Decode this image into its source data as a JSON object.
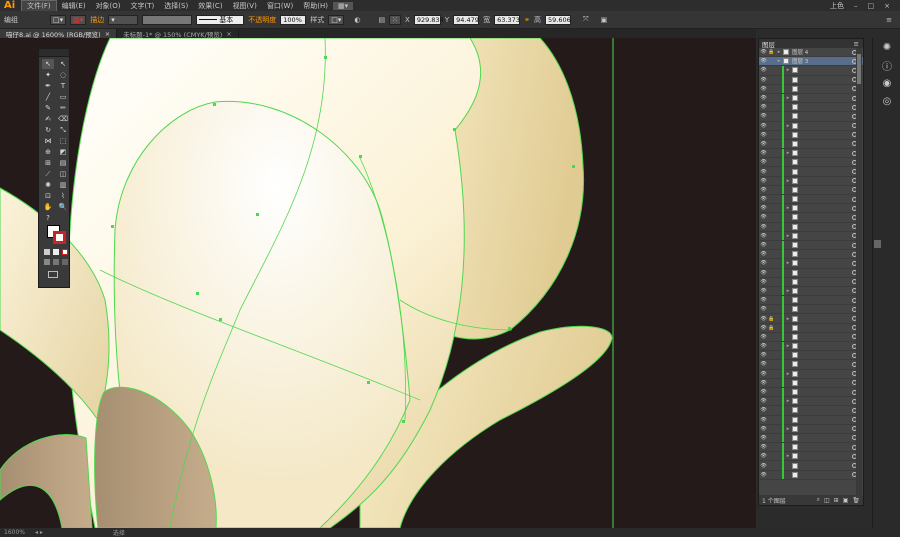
{
  "app": {
    "logo": "Ai",
    "menus": [
      "文件(F)",
      "编辑(E)",
      "对象(O)",
      "文字(T)",
      "选择(S)",
      "效果(C)",
      "视图(V)",
      "窗口(W)",
      "帮助(H)"
    ],
    "right_label": "上色",
    "window_buttons": [
      "–",
      "□",
      "×"
    ]
  },
  "controlbar": {
    "selection_label": "编组",
    "stroke_label": "描边",
    "stroke_style": "基本",
    "opacity_label": "不透明度",
    "opacity_value": "100%",
    "style_label": "样式",
    "x_label": "X",
    "x_value": "929.834",
    "y_label": "Y",
    "y_value": "94.479",
    "w_label": "宽",
    "w_value": "63.373",
    "h_label": "高",
    "h_value": "59.606"
  },
  "tabs": [
    {
      "label": "喵仔8.ai @ 1600% (RGB/预览)",
      "active": true
    },
    {
      "label": "未标题-1* @ 150% (CMYK/预览)",
      "active": false
    }
  ],
  "status": {
    "zoom": "1600%",
    "tool": "选择"
  },
  "layers_panel": {
    "title": "图层",
    "top_rows": [
      {
        "label": "图层 4",
        "locked": true
      },
      {
        "label": "图层 3",
        "locked": false,
        "highlight": true
      }
    ],
    "footer_label": "1 个图层"
  },
  "colors": {
    "canvas_bg": "#231a19",
    "petal_light": "#fdf7e2",
    "petal_dark": "#e2cf9a",
    "path_green": "#4fd84f",
    "layer_bar": "#37c837",
    "accent_orange": "#ff9a00"
  }
}
